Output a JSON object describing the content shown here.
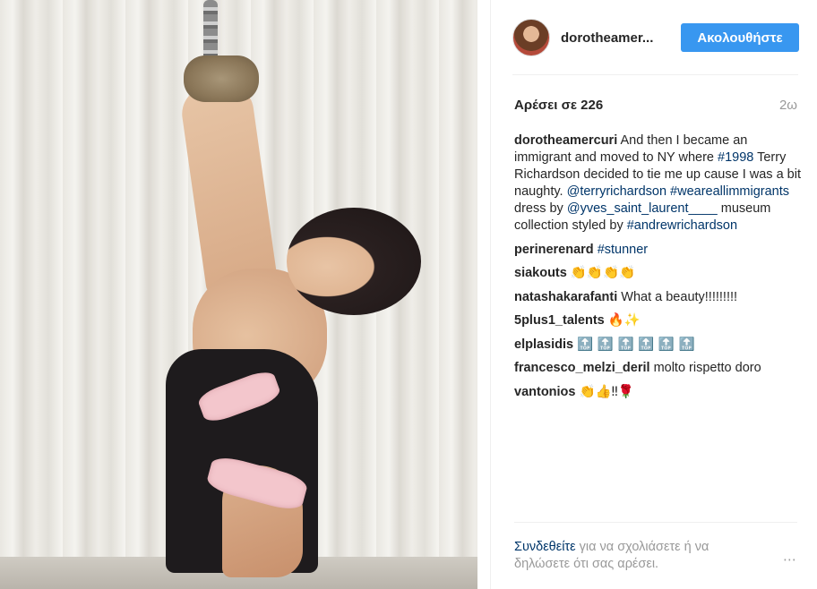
{
  "post": {
    "username": "dorotheamer...",
    "follow_label": "Ακολουθήστε",
    "likes_label": "Αρέσει σε 226",
    "age": "2ω",
    "caption": {
      "user": "dorotheamercuri",
      "t1": " And then I became an immigrant and moved to NY where ",
      "tag1998": "#1998",
      "t2": " Terry Richardson decided to tie me up cause I was a bit naughty. ",
      "mention_terry": "@terryrichardson",
      "t3": " ",
      "tag_immigrants": "#weareallimmigrants",
      "t4": " dress by ",
      "mention_ysl": "@yves_saint_laurent____",
      "t5": " museum collection styled by ",
      "tag_andrew": "#andrewrichardson"
    },
    "comments": [
      {
        "user": "perinerenard",
        "text": "",
        "link": "#stunner"
      },
      {
        "user": "siakouts",
        "text": "👏👏👏👏",
        "link": ""
      },
      {
        "user": "natashakarafanti",
        "text": "What a beauty!!!!!!!!!",
        "link": ""
      },
      {
        "user": "5plus1_talents",
        "text": "🔥✨",
        "link": ""
      },
      {
        "user": "elplasidis",
        "text": "🔝 🔝 🔝 🔝 🔝 🔝",
        "link": ""
      },
      {
        "user": "francesco_melzi_deril",
        "text": "molto rispetto doro",
        "link": ""
      },
      {
        "user": "vantonios",
        "text": "👏👍‼🌹",
        "link": ""
      }
    ],
    "footer": {
      "login_link": "Συνδεθείτε",
      "login_rest": " για να σχολιάσετε ή να δηλώσετε ότι σας αρέσει.",
      "more": "⋯"
    }
  },
  "icons": {
    "more": "more-options-icon"
  },
  "colors": {
    "follow": "#3897f0",
    "link": "#003569",
    "muted": "#999999"
  }
}
